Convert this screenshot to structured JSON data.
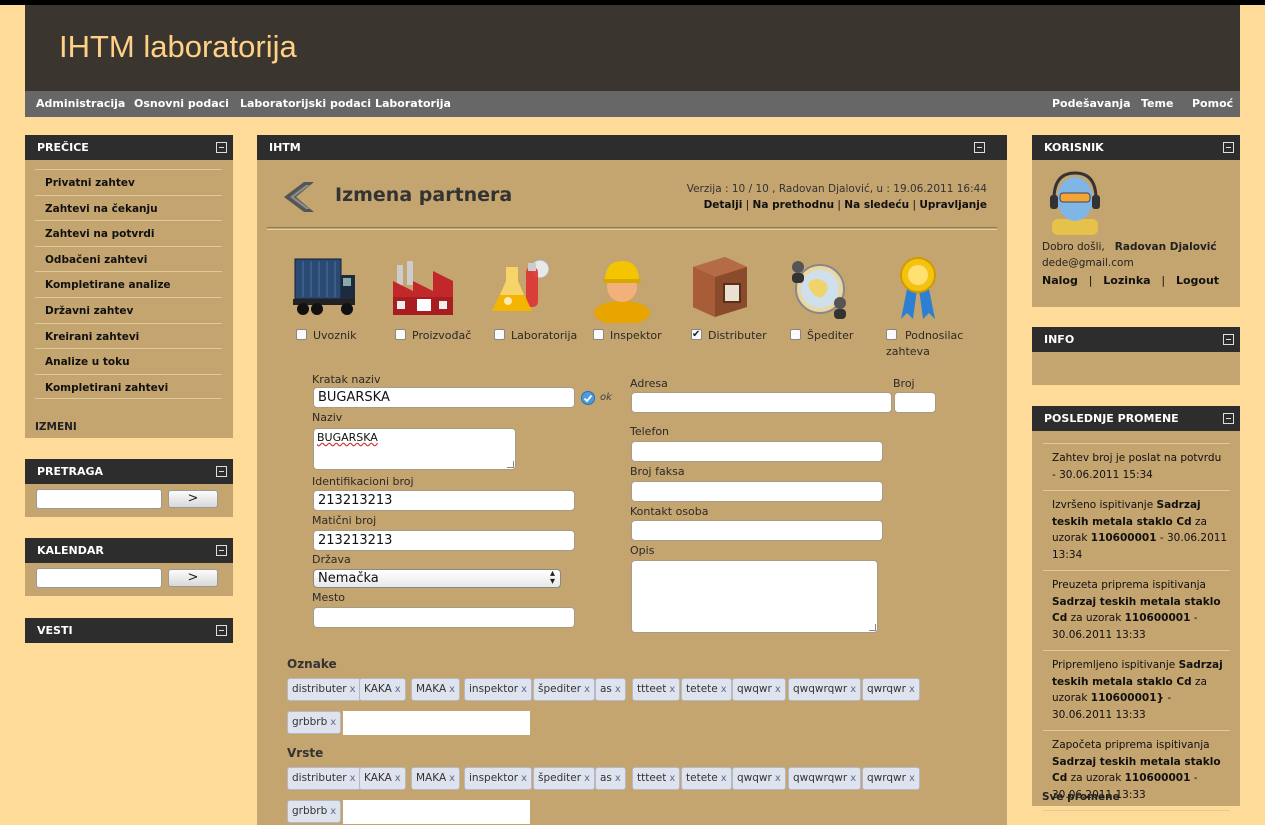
{
  "app": {
    "title": "IHTM laboratorija"
  },
  "menu": {
    "left": [
      "Administracija",
      "Osnovni podaci",
      "Laboratorijski podaci",
      "Laboratorija"
    ],
    "right": [
      "Podešavanja",
      "Teme",
      "Pomoć"
    ]
  },
  "shortcuts": {
    "title": "PREČICE",
    "items": [
      "Privatni zahtev",
      "Zahtevi na čekanju",
      "Zahtevi na potvrdi",
      "Odbačeni zahtevi",
      "Kompletirane analize",
      "Državni zahtev",
      "Kreirani zahtevi",
      "Analize u toku",
      "Kompletirani zahtevi"
    ],
    "footer": "IZMENI"
  },
  "search": {
    "title": "PRETRAGA",
    "button": ">"
  },
  "calendar": {
    "title": "KALENDAR",
    "button": ">"
  },
  "news_panel": {
    "title": "VESTI"
  },
  "main": {
    "panel_title": "IHTM",
    "page_title": "Izmena partnera",
    "version": "Verzija : 10 / 10 , Radovan Djalović, u : 19.06.2011 16:44",
    "links": [
      "Detalji",
      "Na prethodnu",
      "Na sledeću",
      "Upravljanje"
    ],
    "roles": [
      {
        "label": "Uvoznik",
        "checked": false,
        "icon": "truck-icon"
      },
      {
        "label": "Proizvođač",
        "checked": false,
        "icon": "factory-icon"
      },
      {
        "label": "Laboratorija",
        "checked": false,
        "icon": "lab-flask-icon"
      },
      {
        "label": "Inspektor",
        "checked": false,
        "icon": "inspector-icon"
      },
      {
        "label": "Distributer",
        "checked": true,
        "icon": "warehouse-icon"
      },
      {
        "label": "Špediter",
        "checked": false,
        "icon": "globe-users-icon"
      },
      {
        "label": "Podnosilac zahteva",
        "checked": false,
        "icon": "award-ribbon-icon"
      }
    ],
    "form": {
      "kratak_naziv": {
        "label": "Kratak naziv",
        "value": "BUGARSKA",
        "status": "ok"
      },
      "naziv": {
        "label": "Naziv",
        "value": "BUGARSKA"
      },
      "identifikacioni_broj": {
        "label": "Identifikacioni broj",
        "value": "213213213"
      },
      "maticni_broj": {
        "label": "Matični broj",
        "value": "213213213"
      },
      "drzava": {
        "label": "Država",
        "value": "Nemačka"
      },
      "mesto": {
        "label": "Mesto",
        "value": ""
      },
      "adresa": {
        "label": "Adresa",
        "value": ""
      },
      "broj": {
        "label": "Broj",
        "value": ""
      },
      "telefon": {
        "label": "Telefon",
        "value": ""
      },
      "broj_faksa": {
        "label": "Broj faksa",
        "value": ""
      },
      "kontakt_osoba": {
        "label": "Kontakt osoba",
        "value": ""
      },
      "opis": {
        "label": "Opis",
        "value": ""
      }
    },
    "oznake": {
      "title": "Oznake",
      "tags": [
        "distributer",
        "KAKA",
        "MAKA",
        "inspektor",
        "špediter",
        "as",
        "ttteet",
        "tetete",
        "qwqwr",
        "qwqwrqwr",
        "qwrqwr",
        "grbbrb"
      ]
    },
    "vrste": {
      "title": "Vrste",
      "tags": [
        "distributer",
        "KAKA",
        "MAKA",
        "inspektor",
        "špediter",
        "as",
        "ttteet",
        "tetete",
        "qwqwr",
        "qwqwrqwr",
        "qwrqwr",
        "grbbrb"
      ]
    },
    "tag_remove": "x"
  },
  "user": {
    "title": "KORISNIK",
    "welcome": "Dobro došli,",
    "name": "Radovan Djalović",
    "email": "dede@gmail.com",
    "links": [
      "Nalog",
      "Lozinka",
      "Logout"
    ]
  },
  "info": {
    "title": "INFO"
  },
  "recent": {
    "title": "POSLEDNJE PROMENE",
    "items": [
      [
        {
          "t": "Zahtev broj je poslat na potvrdu - 30.06.2011 15:34",
          "b": false
        }
      ],
      [
        {
          "t": "Izvršeno ispitivanje ",
          "b": false
        },
        {
          "t": "Sadrzaj teskih metala staklo Cd",
          "b": true
        },
        {
          "t": " za uzorak ",
          "b": false
        },
        {
          "t": "110600001",
          "b": true
        },
        {
          "t": " - 30.06.2011 13:34",
          "b": false
        }
      ],
      [
        {
          "t": "Preuzeta priprema ispitivanja ",
          "b": false
        },
        {
          "t": "Sadrzaj teskih metala staklo Cd",
          "b": true
        },
        {
          "t": " za uzorak ",
          "b": false
        },
        {
          "t": "110600001",
          "b": true
        },
        {
          "t": " - 30.06.2011 13:33",
          "b": false
        }
      ],
      [
        {
          "t": "Pripremljeno ispitivanje ",
          "b": false
        },
        {
          "t": "Sadrzaj teskih metala staklo Cd",
          "b": true
        },
        {
          "t": " za uzorak ",
          "b": false
        },
        {
          "t": "110600001}",
          "b": true
        },
        {
          "t": " - 30.06.2011 13:33",
          "b": false
        }
      ],
      [
        {
          "t": "Započeta priprema ispitivanja ",
          "b": false
        },
        {
          "t": "Sadrzaj teskih metala staklo Cd",
          "b": true
        },
        {
          "t": " za uzorak ",
          "b": false
        },
        {
          "t": "110600001",
          "b": true
        },
        {
          "t": " - 30.06.2011 13:33",
          "b": false
        }
      ]
    ],
    "footer": "Sve promene"
  }
}
